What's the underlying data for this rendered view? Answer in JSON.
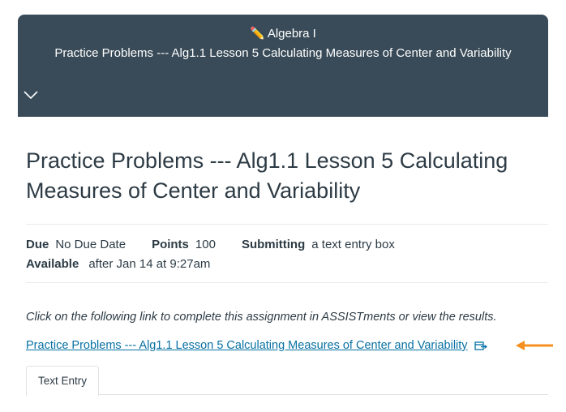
{
  "header": {
    "course_icon": "pencil-icon",
    "course_glyph": "✏️",
    "course_name": "Algebra I",
    "assignment_name": "Practice Problems --- Alg1.1 Lesson 5 Calculating Measures of Center and Variability",
    "toggle_icon": "chevron-down-icon"
  },
  "main": {
    "title": "Practice Problems --- Alg1.1 Lesson 5 Calculating Measures of Center and Variability",
    "details": {
      "due_label": "Due",
      "due_value": "No Due Date",
      "points_label": "Points",
      "points_value": "100",
      "submitting_label": "Submitting",
      "submitting_value": "a text entry box",
      "available_label": "Available",
      "available_value": "after Jan 14 at 9:27am"
    },
    "instructions": "Click on the following link to complete this assignment in ASSISTments or view the results.",
    "external_link": {
      "text": "Practice Problems --- Alg1.1 Lesson 5 Calculating Measures of Center and Variability",
      "icon": "external-link-icon"
    },
    "annotation_icon": "arrow-left-icon",
    "tabs": [
      {
        "label": "Text Entry"
      }
    ]
  },
  "colors": {
    "header_bg": "#394b58",
    "link": "#0770a3",
    "arrow": "#f5901f",
    "text": "#2d3b45"
  }
}
